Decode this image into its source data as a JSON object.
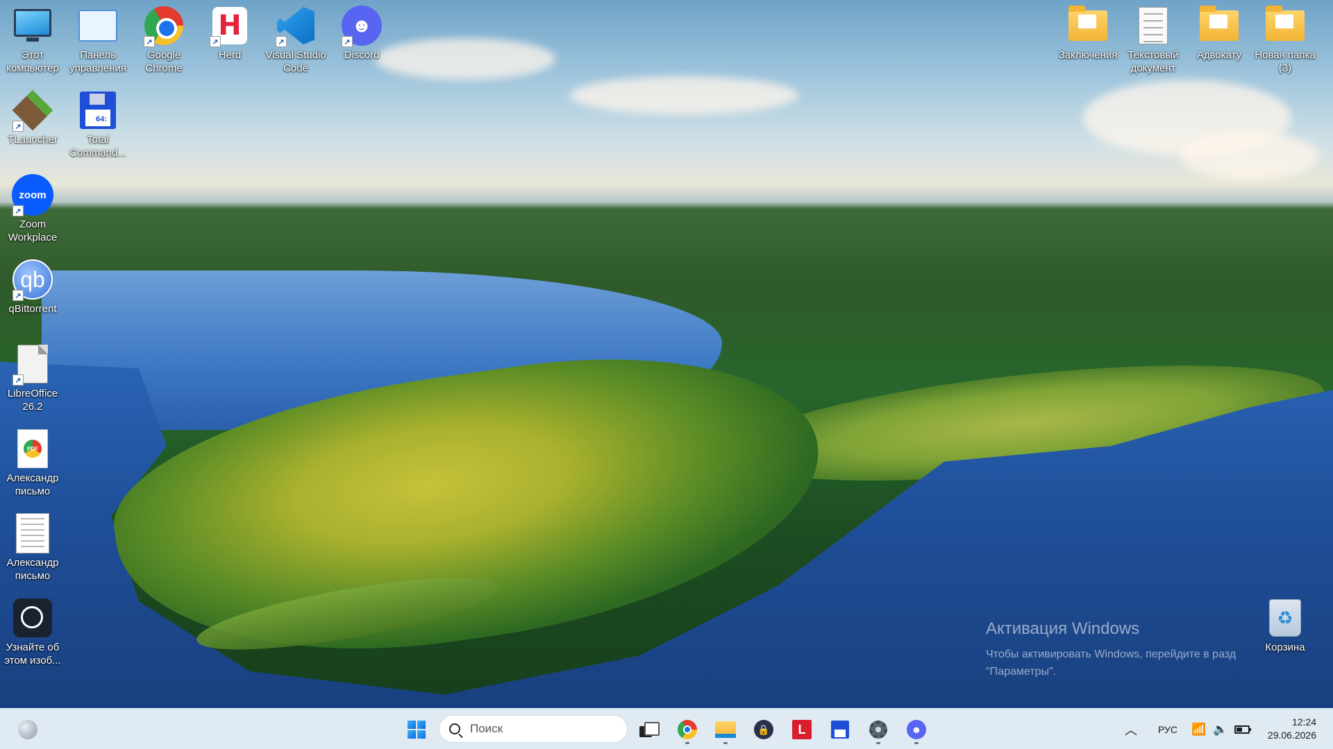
{
  "desktop": {
    "icons_left": [
      {
        "label": "Этот компьютер",
        "icon": "computer-icon",
        "shortcut": false
      },
      {
        "label": "Панель управления",
        "icon": "control-panel-icon",
        "shortcut": false
      },
      {
        "label": "Google Chrome",
        "icon": "chrome-icon",
        "shortcut": true
      },
      {
        "label": "Herd",
        "icon": "herd-icon",
        "shortcut": true
      },
      {
        "label": "Visual Studio Code",
        "icon": "vscode-icon",
        "shortcut": true
      },
      {
        "label": "Discord",
        "icon": "discord-icon",
        "shortcut": true
      },
      {
        "label": "TLauncher",
        "icon": "tlauncher-icon",
        "shortcut": true
      },
      {
        "label": "Total Command...",
        "icon": "total-commander-icon",
        "shortcut": false
      },
      {
        "label": "Zoom Workplace",
        "icon": "zoom-icon",
        "shortcut": true
      },
      {
        "label": "qBittorrent",
        "icon": "qbittorrent-icon",
        "shortcut": true
      },
      {
        "label": "LibreOffice 26.2",
        "icon": "libreoffice-icon",
        "shortcut": true
      },
      {
        "label": "Александр письмо",
        "icon": "pdf-file-icon",
        "shortcut": false
      },
      {
        "label": "Александр письмо",
        "icon": "document-file-icon",
        "shortcut": false
      },
      {
        "label": "Узнайте об этом изоб...",
        "icon": "learn-about-picture-icon",
        "shortcut": false
      }
    ],
    "icons_right": [
      {
        "label": "Заключения",
        "icon": "folder-icon"
      },
      {
        "label": "Текстовый документ",
        "icon": "text-document-icon"
      },
      {
        "label": "Адвокату",
        "icon": "folder-icon"
      },
      {
        "label": "Новая папка (3)",
        "icon": "folder-icon"
      },
      {
        "label": "Корзина",
        "icon": "recycle-bin-icon"
      }
    ],
    "herd_letter": "H",
    "zoom_text": "zoom",
    "qb_text": "qb",
    "pdf_text": "PDF",
    "floppy_text": "64:"
  },
  "watermark": {
    "title": "Активация Windows",
    "line1": "Чтобы активировать Windows, перейдите в разд",
    "line2": "\"Параметры\"."
  },
  "taskbar": {
    "search_placeholder": "Поиск",
    "pinned": [
      {
        "name": "task-view",
        "running": false
      },
      {
        "name": "chrome",
        "running": true
      },
      {
        "name": "file-explorer",
        "running": true
      },
      {
        "name": "vpn-lock",
        "running": false
      },
      {
        "name": "l-app",
        "running": false
      },
      {
        "name": "total-commander",
        "running": false
      },
      {
        "name": "settings",
        "running": true
      },
      {
        "name": "discord",
        "running": true
      }
    ],
    "tray": {
      "language": "РУС",
      "time": "12:24",
      "date": "29.06.2026"
    }
  }
}
